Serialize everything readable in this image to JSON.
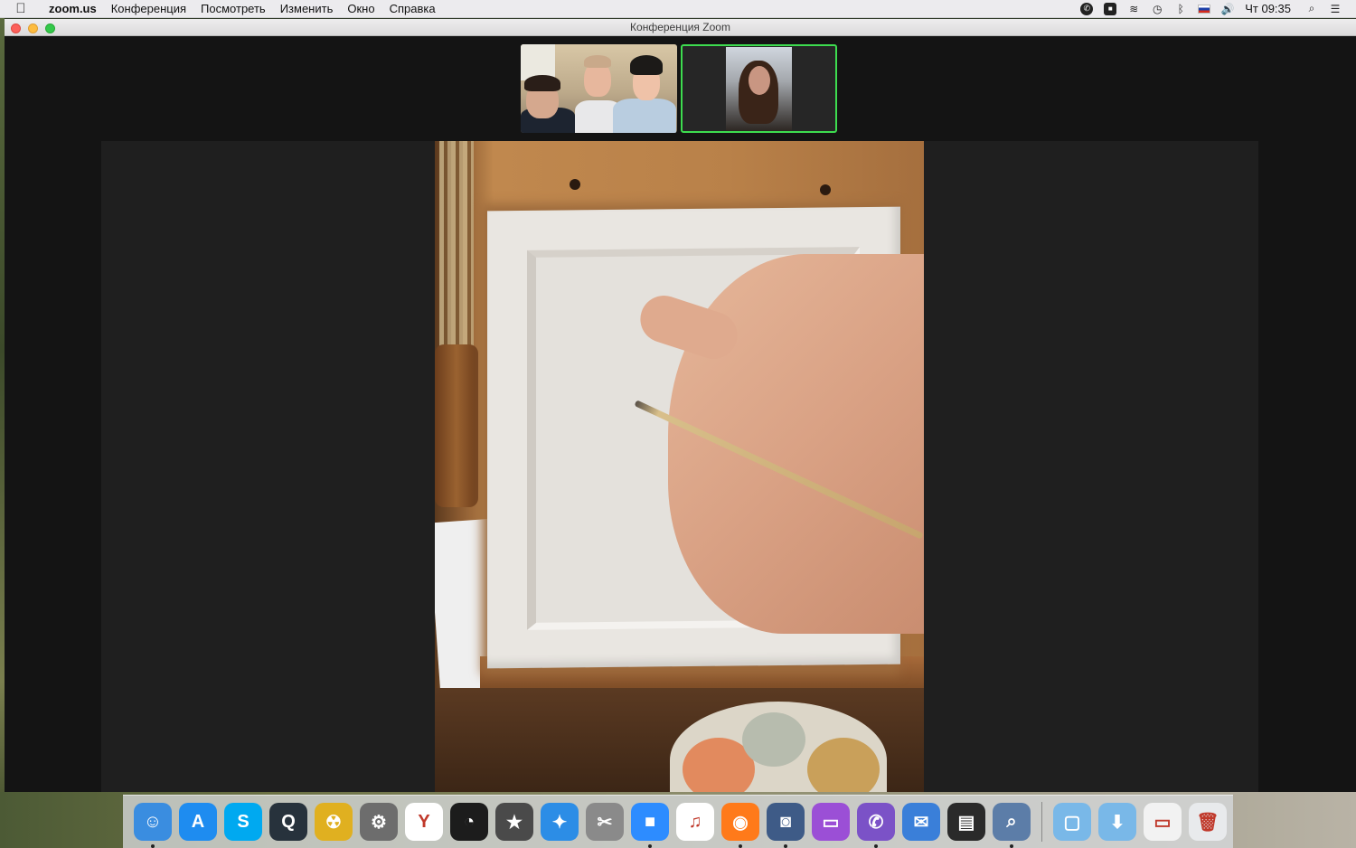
{
  "menubar": {
    "app_name": "zoom.us",
    "items": [
      "Конференция",
      "Посмотреть",
      "Изменить",
      "Окно",
      "Справка"
    ],
    "clock": "Чт 09:35"
  },
  "window": {
    "title": "Конференция Zoom"
  },
  "dock": {
    "apps": [
      {
        "name": "finder-icon",
        "glyph": "☺",
        "color": "#3a8de0",
        "running": true
      },
      {
        "name": "app-store-icon",
        "glyph": "A",
        "color": "#1e8cf0",
        "running": false
      },
      {
        "name": "skype-icon",
        "glyph": "S",
        "color": "#00a9f0",
        "running": false
      },
      {
        "name": "quicktime-icon",
        "glyph": "Q",
        "color": "#27323c",
        "running": false
      },
      {
        "name": "radiation-app-icon",
        "glyph": "☢",
        "color": "#e0b020",
        "running": false
      },
      {
        "name": "system-preferences-icon",
        "glyph": "⚙",
        "color": "#6d6d6d",
        "running": false
      },
      {
        "name": "yandex-browser-icon",
        "glyph": "Y",
        "color": "#ffffff",
        "running": false
      },
      {
        "name": "dashboard-icon",
        "glyph": "◔",
        "color": "#1c1c1c",
        "running": false
      },
      {
        "name": "imovie-icon",
        "glyph": "★",
        "color": "#4a4a4a",
        "running": false
      },
      {
        "name": "safari-icon",
        "glyph": "✦",
        "color": "#2c8de6",
        "running": false
      },
      {
        "name": "preview-icon",
        "glyph": "✂",
        "color": "#8a8a8a",
        "running": false
      },
      {
        "name": "zoom-icon",
        "glyph": "■",
        "color": "#2d8cff",
        "running": true
      },
      {
        "name": "itunes-icon",
        "glyph": "♫",
        "color": "#ffffff",
        "running": false
      },
      {
        "name": "firefox-icon",
        "glyph": "◉",
        "color": "#ff7a1a",
        "running": true
      },
      {
        "name": "image-capture-icon",
        "glyph": "◙",
        "color": "#3e5b87",
        "running": true
      },
      {
        "name": "monitor-app-icon",
        "glyph": "▭",
        "color": "#9b4fd6",
        "running": false
      },
      {
        "name": "viber-icon",
        "glyph": "✆",
        "color": "#7b52c7",
        "running": true
      },
      {
        "name": "mail-icon",
        "glyph": "✉",
        "color": "#3a7fd9",
        "running": false
      },
      {
        "name": "printer-icon",
        "glyph": "▤",
        "color": "#2a2a2a",
        "running": false
      },
      {
        "name": "image-viewer-icon",
        "glyph": "⌕",
        "color": "#5c7da8",
        "running": true
      }
    ],
    "folders": [
      {
        "name": "documents-folder-icon",
        "glyph": "▢",
        "color": "#79b8e8"
      },
      {
        "name": "downloads-folder-icon",
        "glyph": "⬇",
        "color": "#79b8e8"
      },
      {
        "name": "firefox-stack-icon",
        "glyph": "▭",
        "color": "#f2f2f2"
      },
      {
        "name": "trash-icon",
        "glyph": "🗑",
        "color": "#e8eaec"
      }
    ]
  }
}
